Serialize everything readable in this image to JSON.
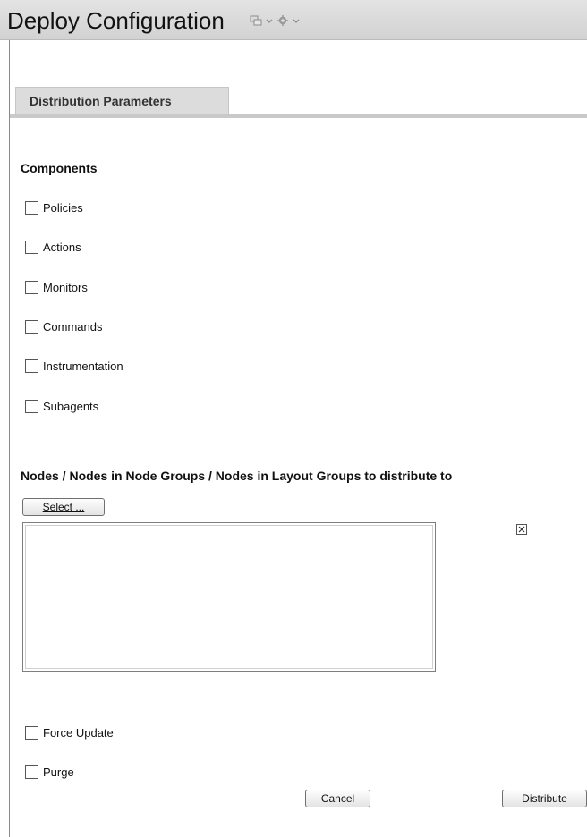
{
  "header": {
    "title": "Deploy Configuration",
    "icons": [
      "window-icon",
      "chevron-down-icon",
      "gear-icon",
      "chevron-down-icon"
    ]
  },
  "tabs": [
    {
      "label": "Distribution Parameters",
      "active": true
    }
  ],
  "components": {
    "heading": "Components",
    "items": [
      {
        "label": "Policies",
        "checked": false
      },
      {
        "label": "Actions",
        "checked": false
      },
      {
        "label": "Monitors",
        "checked": false
      },
      {
        "label": "Commands",
        "checked": false
      },
      {
        "label": "Instrumentation",
        "checked": false
      },
      {
        "label": "Subagents",
        "checked": false
      }
    ]
  },
  "nodes": {
    "heading": "Nodes / Nodes in Node Groups / Nodes in Layout Groups to distribute to",
    "select_label": "Select ...",
    "items": []
  },
  "options": {
    "force_update": {
      "label": "Force Update",
      "checked": false
    },
    "purge": {
      "label": "Purge",
      "checked": false
    }
  },
  "footer": {
    "cancel_label": "Cancel",
    "distribute_label": "Distribute"
  },
  "colors": {
    "titlebar": "#d8d8d8",
    "tab": "#dcdcdc",
    "text": "#111111"
  }
}
